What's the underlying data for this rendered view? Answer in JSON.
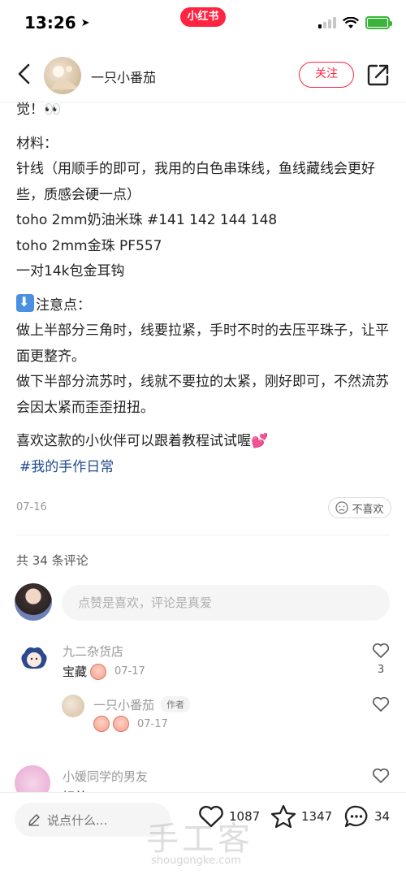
{
  "status_bar": {
    "time": "13:26",
    "brand": "小红书"
  },
  "header": {
    "author_name": "一只小番茄",
    "follow_label": "关注"
  },
  "post": {
    "line_top": "觉！👀",
    "materials_title": "材料：",
    "materials": [
      "针线（用顺手的即可，我用的白色串珠线，鱼线藏线会更好些，质感会硬一点）",
      "toho 2mm奶油米珠 #141 142 144 148",
      "toho 2mm金珠 PF557",
      "一对14k包金耳钩"
    ],
    "notes_title": "注意点：",
    "notes": [
      "做上半部分三角时，线要拉紧，手时不时的去压平珠子，让平面更整齐。",
      "做下半部分流苏时，线就不要拉的太紧，刚好即可，不然流苏会因太紧而歪歪扭扭。"
    ],
    "closing": "喜欢这款的小伙伴可以跟着教程试试喔💕",
    "hashtag": "#我的手作日常",
    "date": "07-16",
    "dislike_label": "不喜欢"
  },
  "comments_section": {
    "count_label": "共 34 条评论",
    "input_placeholder": "点赞是喜欢，评论是真爱",
    "comments": [
      {
        "name": "九二杂货店",
        "text": "宝藏",
        "date": "07-17",
        "likes": "3"
      },
      {
        "name": "一只小番茄",
        "author_tag": "作者",
        "date": "07-17"
      },
      {
        "name": "小媛同学的男友",
        "text": "好美"
      }
    ]
  },
  "bottom_bar": {
    "input_placeholder": "说点什么...",
    "likes": "1087",
    "favorites": "1347",
    "comments": "34"
  },
  "watermark": {
    "main": "手工客",
    "sub": "shougongke.com"
  },
  "colors": {
    "brand": "#ff2442",
    "hashtag": "#224d8f",
    "battery": "#3cb43c"
  }
}
